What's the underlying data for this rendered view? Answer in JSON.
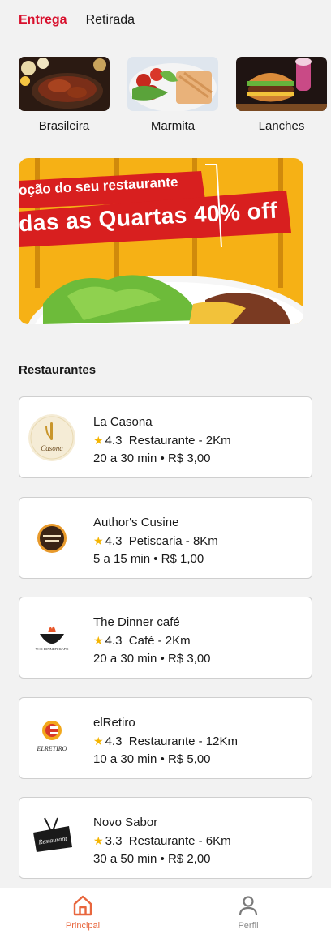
{
  "tabs": [
    {
      "label": "Entrega",
      "active": true
    },
    {
      "label": "Retirada",
      "active": false
    }
  ],
  "categories": [
    {
      "label": "Brasileira"
    },
    {
      "label": "Marmita"
    },
    {
      "label": "Lanches"
    }
  ],
  "banner": {
    "line1": "oção do seu restaurante",
    "line2": "das as Quartas 40% off"
  },
  "section_title": "Restaurantes",
  "restaurants": [
    {
      "name": "La Casona",
      "rating": "4.3",
      "category": "Restaurante - 2Km",
      "delivery": "20 a 30 min • R$ 3,00"
    },
    {
      "name": "Author's Cusine",
      "rating": "4.3",
      "category": "Petiscaria - 8Km",
      "delivery": "5 a 15 min • R$ 1,00"
    },
    {
      "name": "The Dinner café",
      "rating": "4.3",
      "category": "Café - 2Km",
      "delivery": "20 a 30 min • R$ 3,00"
    },
    {
      "name": "elRetiro",
      "rating": "4.3",
      "category": "Restaurante - 12Km",
      "delivery": "10 a 30 min • R$ 5,00"
    },
    {
      "name": "Novo Sabor",
      "rating": "3.3",
      "category": "Restaurante - 6Km",
      "delivery": "30 a 50 min • R$ 2,00"
    }
  ],
  "logo_text": {
    "casona": "Casona",
    "dinner": "THE DINNER CAFE",
    "elretiro": "ELRETIRO",
    "novo": "Restaurant"
  },
  "bottom_nav": [
    {
      "label": "Principal",
      "icon": "home-icon",
      "active": true
    },
    {
      "label": "Perfil",
      "icon": "user-icon",
      "active": false
    }
  ],
  "colors": {
    "accent_red": "#d8102d",
    "nav_active": "#e8663d",
    "star": "#f4b400",
    "banner_bg": "#f7b617"
  }
}
